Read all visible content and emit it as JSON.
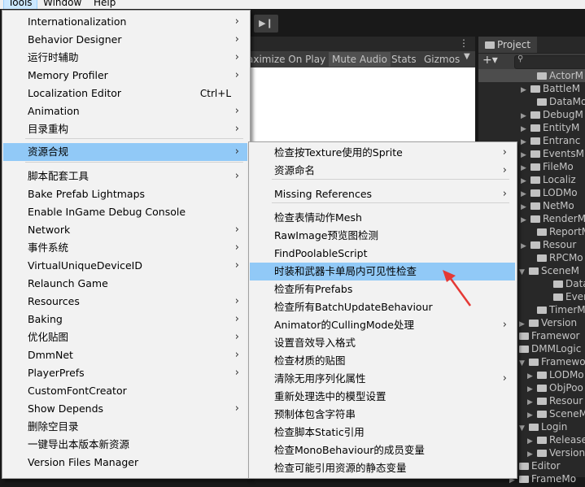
{
  "menubar": {
    "items": [
      "Tools",
      "Window",
      "Help"
    ]
  },
  "toolbar": {
    "step_icon": "step-forward-icon"
  },
  "game_view": {
    "options": [
      "aximize On Play",
      "Mute Audio",
      "Stats",
      "Gizmos"
    ]
  },
  "project": {
    "tab_label": "Project",
    "tree": [
      "ActorM",
      "BattleM",
      "DataMo",
      "DebugM",
      "EntityM",
      "Entranc",
      "EventsM",
      "FileMo",
      "Localiz",
      "LODMo",
      "NetMo",
      "RenderM",
      "ReportM",
      "Resour",
      "RPCMo",
      "SceneM",
      "Data",
      "Even",
      "TimerM",
      "Version",
      "Framewor",
      "DMMLogic",
      "Framewor",
      "LODMo",
      "ObjPoo",
      "Resour",
      "SceneM",
      "Login",
      "Release",
      "Version",
      "Editor",
      "FrameMo"
    ]
  },
  "tools_menu": {
    "items": [
      {
        "label": "Internationalization",
        "shortcut": "",
        "submenu": true
      },
      {
        "label": "Behavior Designer",
        "shortcut": "",
        "submenu": true
      },
      {
        "label": "运行时辅助",
        "shortcut": "",
        "submenu": true
      },
      {
        "label": "Memory Profiler",
        "shortcut": "",
        "submenu": true
      },
      {
        "label": "Localization Editor",
        "shortcut": "Ctrl+L",
        "submenu": false
      },
      {
        "label": "Animation",
        "shortcut": "",
        "submenu": true
      },
      {
        "label": "目录重构",
        "shortcut": "",
        "submenu": true
      },
      {
        "label": "资源合规",
        "shortcut": "",
        "submenu": true
      },
      {
        "label": "脚本配套工具",
        "shortcut": "",
        "submenu": true
      },
      {
        "label": "Bake Prefab Lightmaps",
        "shortcut": "",
        "submenu": false
      },
      {
        "label": "Enable InGame Debug Console",
        "shortcut": "",
        "submenu": false
      },
      {
        "label": "Network",
        "shortcut": "",
        "submenu": true
      },
      {
        "label": "事件系统",
        "shortcut": "",
        "submenu": true
      },
      {
        "label": "VirtualUniqueDeviceID",
        "shortcut": "",
        "submenu": true
      },
      {
        "label": "Relaunch Game",
        "shortcut": "",
        "submenu": false
      },
      {
        "label": "Resources",
        "shortcut": "",
        "submenu": true
      },
      {
        "label": "Baking",
        "shortcut": "",
        "submenu": true
      },
      {
        "label": "优化贴图",
        "shortcut": "",
        "submenu": true
      },
      {
        "label": "DmmNet",
        "shortcut": "",
        "submenu": true
      },
      {
        "label": "PlayerPrefs",
        "shortcut": "",
        "submenu": true
      },
      {
        "label": "CustomFontCreator",
        "shortcut": "",
        "submenu": false
      },
      {
        "label": "Show Depends",
        "shortcut": "",
        "submenu": true
      },
      {
        "label": "删除空目录",
        "shortcut": "",
        "submenu": false
      },
      {
        "label": "一键导出本版本新资源",
        "shortcut": "",
        "submenu": false
      },
      {
        "label": "Version Files Manager",
        "shortcut": "",
        "submenu": false
      }
    ]
  },
  "submenu": {
    "items": [
      {
        "label": "检查按Texture使用的Sprite",
        "submenu": true
      },
      {
        "label": "资源命名",
        "submenu": true
      },
      {
        "label": "Missing References",
        "submenu": true
      },
      {
        "label": "检查表情动作Mesh",
        "submenu": false
      },
      {
        "label": "RawImage预览图检测",
        "submenu": false
      },
      {
        "label": "FindPoolableScript",
        "submenu": false
      },
      {
        "label": "时装和武器卡单局内可见性检查",
        "submenu": false
      },
      {
        "label": "检查所有Prefabs",
        "submenu": false
      },
      {
        "label": "检查所有BatchUpdateBehaviour",
        "submenu": false
      },
      {
        "label": "Animator的CullingMode处理",
        "submenu": true
      },
      {
        "label": "设置音效导入格式",
        "submenu": false
      },
      {
        "label": "检查材质的贴图",
        "submenu": false
      },
      {
        "label": "清除无用序列化属性",
        "submenu": true
      },
      {
        "label": "重新处理选中的模型设置",
        "submenu": false
      },
      {
        "label": "预制体包含字符串",
        "submenu": false
      },
      {
        "label": "检查脚本Static引用",
        "submenu": false
      },
      {
        "label": "检查MonoBehaviour的成员变量",
        "submenu": false
      },
      {
        "label": "检查可能引用资源的静态变量",
        "submenu": false
      }
    ]
  },
  "colors": {
    "highlight": "#91c9f7",
    "menu_bg": "#f2f2f2",
    "arrow": "#e53935"
  }
}
